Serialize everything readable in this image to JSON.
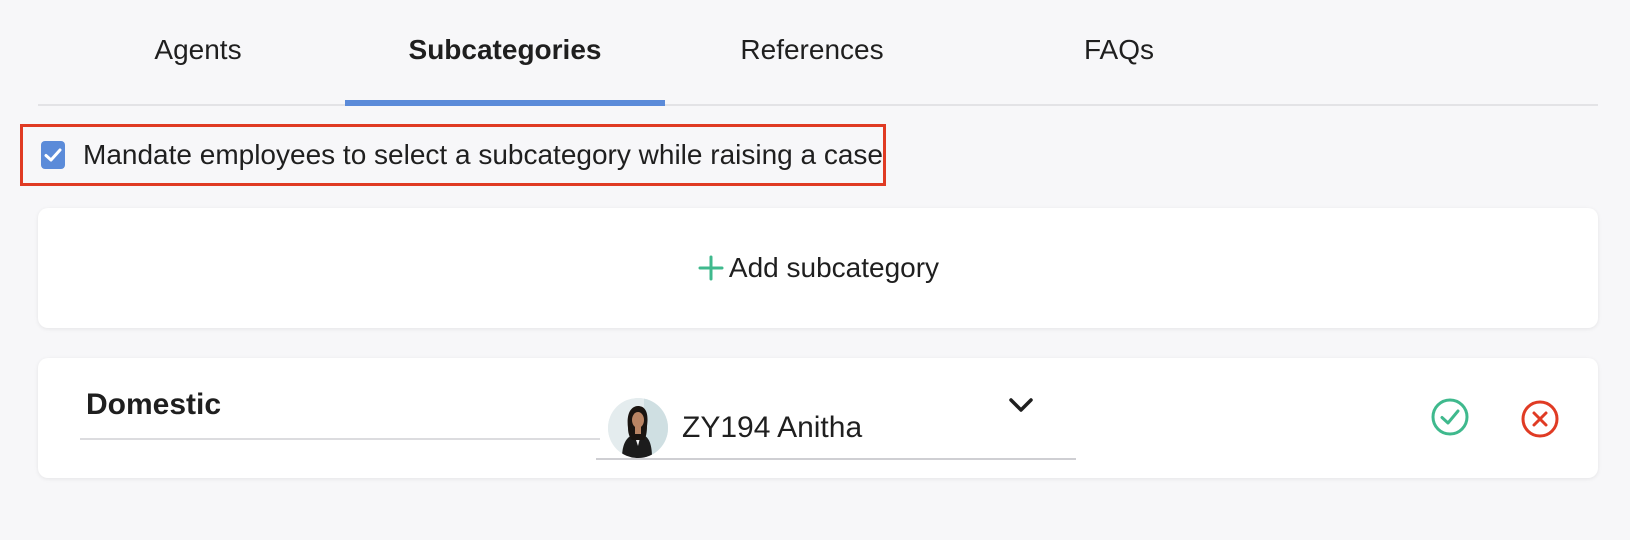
{
  "tabs": [
    {
      "label": "Agents",
      "active": false
    },
    {
      "label": "Subcategories",
      "active": true
    },
    {
      "label": "References",
      "active": false
    },
    {
      "label": "FAQs",
      "active": false
    }
  ],
  "mandate": {
    "checked": true,
    "label": "Mandate employees to select a subcategory while raising a case"
  },
  "add_subcategory": {
    "label": "Add subcategory",
    "icon": "plus-icon"
  },
  "subcategory_row": {
    "name": "Domestic",
    "agent": "ZY194 Anitha",
    "agent_icon": "avatar",
    "dropdown_icon": "chevron-down-icon",
    "confirm_icon": "check-circle-icon",
    "cancel_icon": "close-circle-icon"
  },
  "colors": {
    "accent": "#5b8bd9",
    "highlight_border": "#e03b24",
    "confirm": "#3fb98d",
    "cancel": "#e03b24"
  }
}
